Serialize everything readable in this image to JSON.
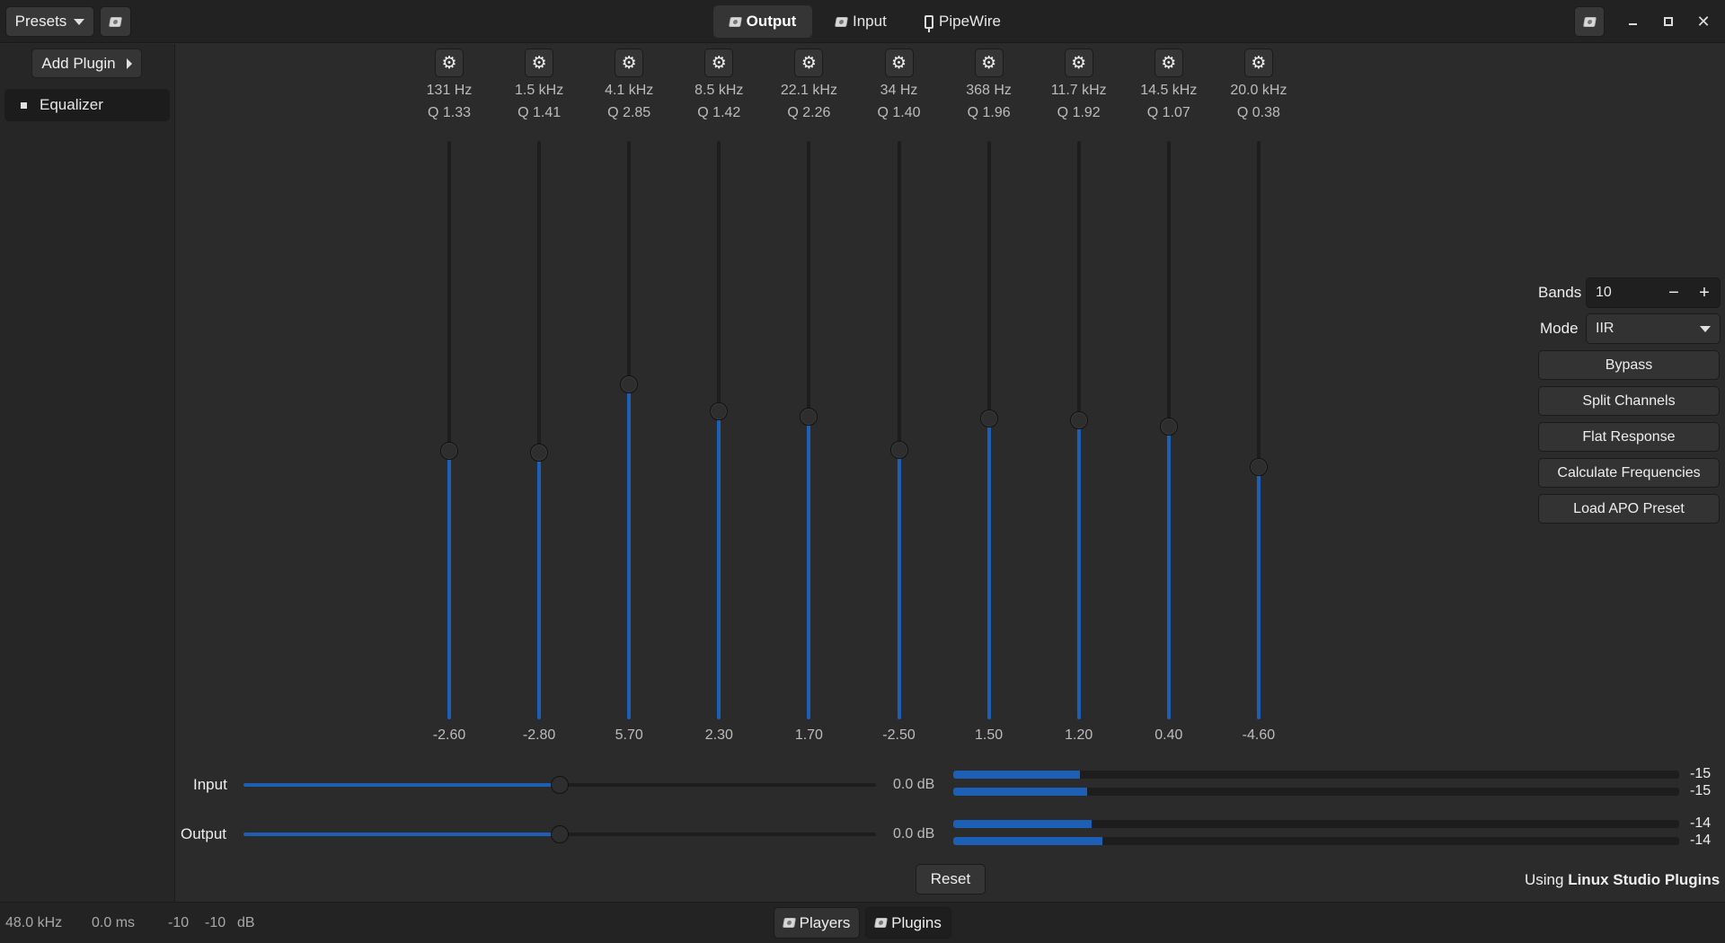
{
  "header": {
    "presets_label": "Presets",
    "tabs": [
      {
        "label": "Output",
        "active": true
      },
      {
        "label": "Input",
        "active": false
      },
      {
        "label": "PipeWire",
        "active": false
      }
    ],
    "close_glyph": "✕"
  },
  "sidebar": {
    "add_plugin_label": "Add Plugin",
    "items": [
      {
        "label": "Equalizer"
      }
    ]
  },
  "equalizer": {
    "accent_color": "#1c5fb5",
    "gain_range": [
      -36,
      36
    ],
    "gear_glyph": "⚙",
    "bands": [
      {
        "freq": "131 Hz",
        "q": "Q 1.33",
        "gain": "-2.60"
      },
      {
        "freq": "1.5 kHz",
        "q": "Q 1.41",
        "gain": "-2.80"
      },
      {
        "freq": "4.1 kHz",
        "q": "Q 2.85",
        "gain": "5.70"
      },
      {
        "freq": "8.5 kHz",
        "q": "Q 1.42",
        "gain": "2.30"
      },
      {
        "freq": "22.1 kHz",
        "q": "Q 2.26",
        "gain": "1.70"
      },
      {
        "freq": "34 Hz",
        "q": "Q 1.40",
        "gain": "-2.50"
      },
      {
        "freq": "368 Hz",
        "q": "Q 1.96",
        "gain": "1.50"
      },
      {
        "freq": "11.7 kHz",
        "q": "Q 1.92",
        "gain": "1.20"
      },
      {
        "freq": "14.5 kHz",
        "q": "Q 1.07",
        "gain": "0.40"
      },
      {
        "freq": "20.0 kHz",
        "q": "Q 0.38",
        "gain": "-4.60"
      }
    ]
  },
  "controls": {
    "bands_label": "Bands",
    "bands_value": "10",
    "minus_glyph": "−",
    "plus_glyph": "+",
    "mode_label": "Mode",
    "mode_value": "IIR",
    "buttons": [
      "Bypass",
      "Split Channels",
      "Flat Response",
      "Calculate Frequencies",
      "Load APO Preset"
    ]
  },
  "gain": {
    "input_label": "Input",
    "input_value": "0.0 dB",
    "input_level": 0.5,
    "output_label": "Output",
    "output_value": "0.0 dB",
    "output_level": 0.5
  },
  "meters": {
    "input": [
      {
        "label": "-15",
        "level": 0.175
      },
      {
        "label": "-15",
        "level": 0.185
      }
    ],
    "output": [
      {
        "label": "-14",
        "level": 0.19
      },
      {
        "label": "-14",
        "level": 0.205
      }
    ]
  },
  "reset_label": "Reset",
  "using": {
    "prefix": "Using",
    "name": "Linux Studio Plugins"
  },
  "footer": {
    "sample_rate": "48.0 kHz",
    "latency": "0.0 ms",
    "level_left": "-10",
    "level_right": "-10",
    "level_unit": "dB",
    "players_label": "Players",
    "plugins_label": "Plugins"
  }
}
